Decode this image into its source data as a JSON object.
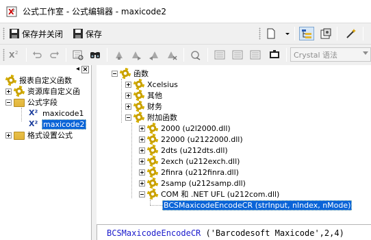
{
  "window": {
    "title": "公式工作室 - 公式编辑器 - maxicode2"
  },
  "toolbar1": {
    "save_close_label": "保存并关闭",
    "save_label": "保存"
  },
  "toolbar2": {
    "syntax_select": "Crystal 语法"
  },
  "left_tree": [
    {
      "label": "报表自定义函数"
    },
    {
      "label": "资源库自定义函"
    },
    {
      "label": "公式字段"
    },
    {
      "label": "maxicode1"
    },
    {
      "label": "maxicode2"
    },
    {
      "label": "格式设置公式"
    }
  ],
  "right_tree": [
    {
      "label": "函数"
    },
    {
      "label": "Xcelsius"
    },
    {
      "label": "其他"
    },
    {
      "label": "财务"
    },
    {
      "label": "附加函数"
    },
    {
      "label": "2000 (u2l2000.dll)"
    },
    {
      "label": "22000 (u2122000.dll)"
    },
    {
      "label": "2dts (u212dts.dll)"
    },
    {
      "label": "2exch (u212exch.dll)"
    },
    {
      "label": "2finra (u212finra.dll)"
    },
    {
      "label": "2samp (u212samp.dll)"
    },
    {
      "label": "COM 和 .NET UFL (u212com.dll)"
    },
    {
      "label": "BCSMaxicodeEncodeCR (strInput, nIndex, nMode)"
    }
  ],
  "editor": {
    "fn": "BCSMaxicodeEncodeCR",
    "rest": " ('Barcodesoft Maxicode',2,4)"
  },
  "colors": {
    "selection": "#0a64d8",
    "keyword": "#1a1acc"
  }
}
